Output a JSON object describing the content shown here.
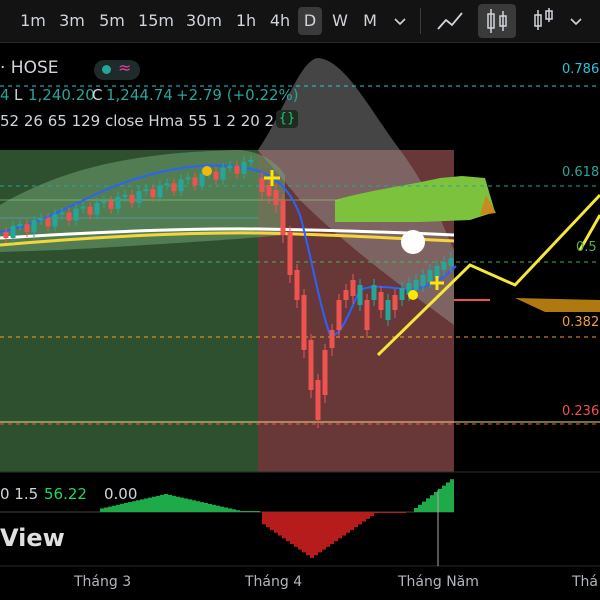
{
  "toolbar": {
    "timeframes": [
      "1m",
      "3m",
      "5m",
      "15m",
      "30m",
      "1h",
      "4h",
      "D",
      "W",
      "M"
    ],
    "active_timeframe": "D"
  },
  "legend": {
    "symbol": "· HOSE",
    "ohlc_partial": "4",
    "low_label": "L",
    "low_value": "1,240.20",
    "close_label": "C",
    "close_value": "1,244.74",
    "change": "+2.79 (+0.22%)",
    "indicator": "52 26 65 129 close Hma 55 1 2 20 2",
    "oscillator_params": "0 1.5",
    "oscillator_value": "56.22",
    "oscillator_value2": "0.00"
  },
  "fib_levels": [
    {
      "label": "0.786",
      "color": "#26c6da"
    },
    {
      "label": "0.618",
      "color": "#26a69a"
    },
    {
      "label": "0.5",
      "color": "#4caf50"
    },
    {
      "label": "0.382",
      "color": "#f0a030"
    },
    {
      "label": "0.236",
      "color": "#ef5350"
    }
  ],
  "watermark": "View",
  "x_axis": [
    "Tháng 3",
    "Tháng 4",
    "Tháng Năm",
    "Thá"
  ]
}
